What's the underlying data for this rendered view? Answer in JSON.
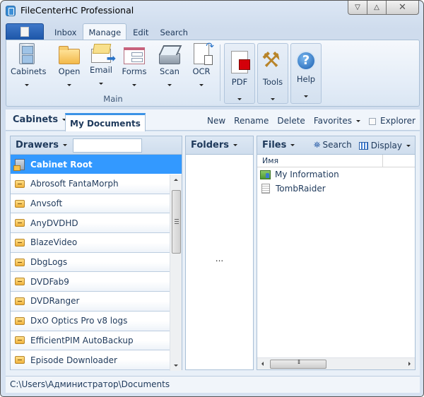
{
  "window": {
    "title": "FileCenterHC Professional",
    "controls": {
      "minimize": "▽",
      "maximize": "△",
      "close": "✕"
    }
  },
  "ribbon": {
    "tabs": [
      {
        "label": "Inbox",
        "active": false
      },
      {
        "label": "Manage",
        "active": true
      },
      {
        "label": "Edit",
        "active": false
      },
      {
        "label": "Search",
        "active": false
      }
    ],
    "main_group": {
      "label": "Main",
      "buttons": [
        {
          "label": "Cabinets",
          "icon": "filing-cabinet-icon"
        },
        {
          "label": "Open",
          "icon": "open-folder-icon"
        },
        {
          "label": "Email",
          "icon": "email-icon"
        },
        {
          "label": "Forms",
          "icon": "forms-icon"
        },
        {
          "label": "Scan",
          "icon": "scanner-icon"
        },
        {
          "label": "OCR",
          "icon": "ocr-icon"
        }
      ]
    },
    "large_buttons": [
      {
        "label": "PDF",
        "icon": "pdf-icon"
      },
      {
        "label": "Tools",
        "icon": "tools-icon"
      },
      {
        "label": "Help",
        "icon": "help-icon",
        "glyph": "?"
      }
    ]
  },
  "nav": {
    "cabinets_label": "Cabinets",
    "active_tab": "My Documents",
    "actions": {
      "new": "New",
      "rename": "Rename",
      "delete": "Delete",
      "favorites": "Favorites",
      "explorer": "Explorer"
    },
    "explorer_checked": false
  },
  "drawers": {
    "title": "Drawers",
    "filter_value": "",
    "selected": "Cabinet Root",
    "items": [
      "Abrosoft FantaMorph",
      "Anvsoft",
      "AnyDVDHD",
      "BlazeVideo",
      "DbgLogs",
      "DVDFab9",
      "DVDRanger",
      "DxO Optics Pro v8 logs",
      "EfficientPIM AutoBackup",
      "Episode Downloader"
    ]
  },
  "folders": {
    "title": "Folders",
    "placeholder": "..."
  },
  "files": {
    "title": "Files",
    "search_label": "Search",
    "display_label": "Display",
    "column_name": "Имя",
    "items": [
      {
        "name": "My Information",
        "icon": "contact-card-icon"
      },
      {
        "name": "TombRaider",
        "icon": "text-file-icon"
      }
    ]
  },
  "status": {
    "path": "C:\\Users\\Администратор\\Documents"
  }
}
